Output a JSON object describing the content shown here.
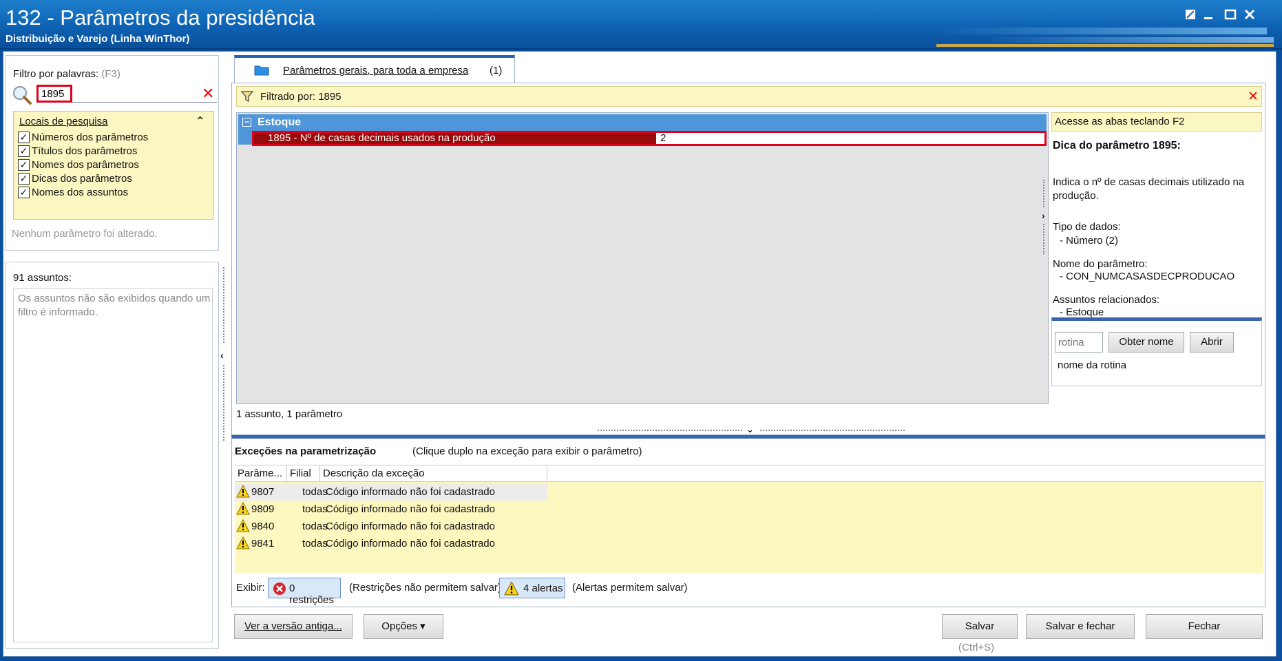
{
  "window": {
    "title": "132 - Parâmetros da presidência",
    "subtitle": "Distribuição e Varejo (Linha WinThor)"
  },
  "filter": {
    "label": "Filtro por palavras:",
    "shortcut": "(F3)",
    "search_value": "1895",
    "locais_title": "Locais de pesquisa",
    "options": [
      {
        "label": "Números dos parâmetros",
        "checked": true
      },
      {
        "label": "Títulos dos parâmetros",
        "checked": true
      },
      {
        "label": "Nomes dos parâmetros",
        "checked": true
      },
      {
        "label": "Dicas dos parâmetros",
        "checked": true
      },
      {
        "label": "Nomes dos assuntos",
        "checked": true
      }
    ],
    "status": "Nenhum parâmetro foi alterado."
  },
  "subjects": {
    "count_label": "91 assuntos:",
    "message": "Os assuntos não são exibidos quando um filtro é informado."
  },
  "tab": {
    "label": "Parâmetros gerais, para toda a empresa",
    "count": "(1)"
  },
  "filtered_bar": {
    "text": "Filtrado por: 1895"
  },
  "grid": {
    "group": "Estoque",
    "row_name": "1895 - Nº de casas decimais usados na produção",
    "row_value": "2",
    "footer": "1 assunto, 1 parâmetro"
  },
  "hint": {
    "banner": "Acesse as abas teclando F2",
    "title": "Dica do parâmetro 1895:",
    "description": "Indica o nº de casas decimais utilizado na produção.",
    "tipo_label": "Tipo de dados:",
    "tipo_value": "- Número (2)",
    "nome_label": "Nome do parâmetro:",
    "nome_value": "- CON_NUMCASASDECPRODUCAO",
    "assuntos_label": "Assuntos relacionados:",
    "assuntos_value": "- Estoque",
    "rotina_placeholder": "rotina",
    "obter_label": "Obter nome",
    "abrir_label": "Abrir",
    "rotina_caption": "nome da rotina"
  },
  "exceptions": {
    "title": "Exceções na parametrização",
    "hint": "(Clique duplo na exceção para exibir o parâmetro)",
    "columns": [
      "Parâme...",
      "Filial",
      "Descrição da exceção"
    ],
    "rows": [
      {
        "param": "9807",
        "filial": "todas",
        "desc": "Código informado não foi cadastrado"
      },
      {
        "param": "9809",
        "filial": "todas",
        "desc": "Código informado não foi cadastrado"
      },
      {
        "param": "9840",
        "filial": "todas",
        "desc": "Código informado não foi cadastrado"
      },
      {
        "param": "9841",
        "filial": "todas",
        "desc": "Código informado não foi cadastrado"
      }
    ],
    "exibir_label": "Exibir:",
    "restricoes_label": "0 restrições",
    "restricoes_note": "(Restrições não permitem salvar)",
    "alertas_label": "4 alertas",
    "alertas_note": "(Alertas permitem salvar)"
  },
  "footer": {
    "ver_label": "Ver a versão antiga...",
    "opcoes_label": "Opções ▾",
    "salvar_label": "Salvar",
    "salvar_shortcut": "(Ctrl+S)",
    "salvar_fechar_label": "Salvar e fechar",
    "fechar_label": "Fechar"
  },
  "colors": {
    "titlebar": "#0e62b3",
    "highlight_red": "#e0001b",
    "group_blue": "#4e96d9",
    "yellow_panel": "#fbf7c2"
  }
}
